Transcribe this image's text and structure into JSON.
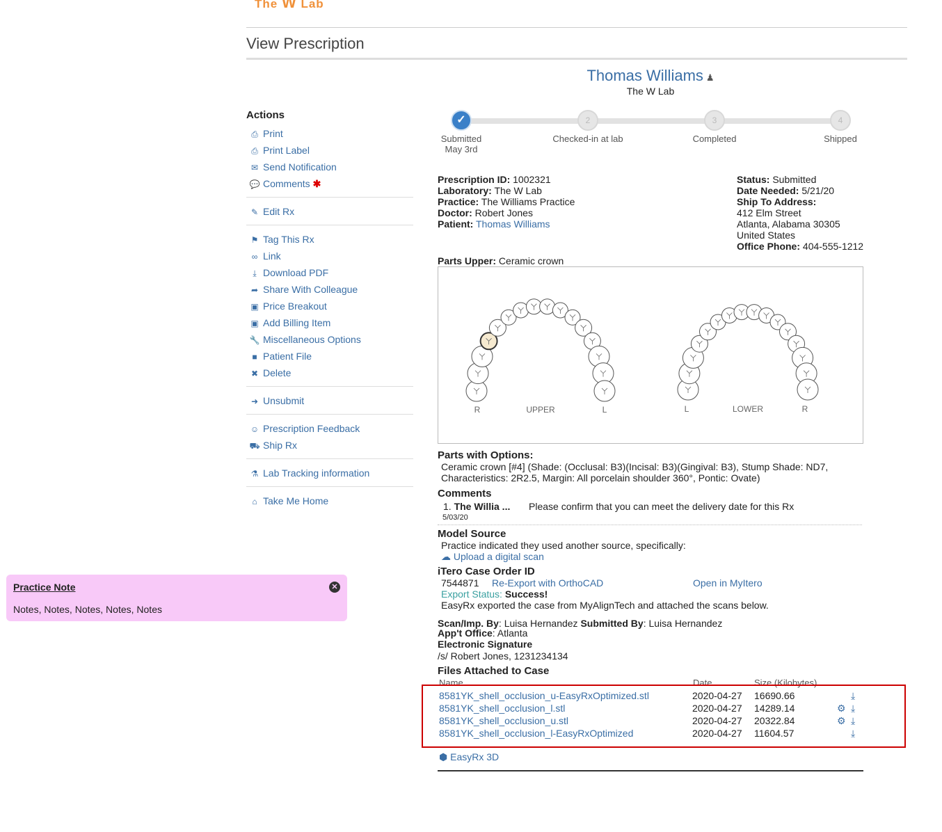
{
  "header": {
    "logo_pre": "The",
    "logo_w": "W",
    "logo_post": "Lab",
    "page_title": "View Prescription"
  },
  "patient_header": {
    "name": "Thomas Williams",
    "lab": "The W Lab"
  },
  "actions": {
    "title": "Actions",
    "groups": [
      [
        {
          "icon": "printer-icon",
          "label": "Print"
        },
        {
          "icon": "printer-icon",
          "label": "Print Label"
        },
        {
          "icon": "envelope-icon",
          "label": "Send Notification"
        },
        {
          "icon": "comments-icon",
          "label": "Comments"
        }
      ],
      [
        {
          "icon": "edit-icon",
          "label": "Edit Rx"
        }
      ],
      [
        {
          "icon": "tag-icon",
          "label": "Tag This Rx"
        },
        {
          "icon": "link-icon",
          "label": "Link"
        },
        {
          "icon": "download-icon",
          "label": "Download PDF"
        },
        {
          "icon": "share-icon",
          "label": "Share With Colleague"
        },
        {
          "icon": "money-icon",
          "label": "Price Breakout"
        },
        {
          "icon": "money-icon",
          "label": "Add Billing Item"
        },
        {
          "icon": "wrench-icon",
          "label": "Miscellaneous Options"
        },
        {
          "icon": "folder-icon",
          "label": "Patient File"
        },
        {
          "icon": "close-icon",
          "label": "Delete"
        }
      ],
      [
        {
          "icon": "arrow-left-icon",
          "label": "Unsubmit"
        }
      ],
      [
        {
          "icon": "smile-icon",
          "label": "Prescription Feedback"
        },
        {
          "icon": "truck-icon",
          "label": "Ship Rx"
        }
      ],
      [
        {
          "icon": "flask-icon",
          "label": "Lab Tracking information"
        }
      ],
      [
        {
          "icon": "home-icon",
          "label": "Take Me Home"
        }
      ]
    ]
  },
  "progress": {
    "steps": [
      {
        "number": "",
        "label": "Submitted",
        "sublabel": "May 3rd",
        "done": true
      },
      {
        "number": "2",
        "label": "Checked-in at lab",
        "sublabel": "",
        "done": false
      },
      {
        "number": "3",
        "label": "Completed",
        "sublabel": "",
        "done": false
      },
      {
        "number": "4",
        "label": "Shipped",
        "sublabel": "",
        "done": false
      }
    ]
  },
  "rx_info": {
    "prescription_id_label": "Prescription ID:",
    "prescription_id": "1002321",
    "laboratory_label": "Laboratory:",
    "laboratory": "The W Lab",
    "practice_label": "Practice:",
    "practice": "The Williams Practice",
    "doctor_label": "Doctor:",
    "doctor": "Robert Jones",
    "patient_label": "Patient:",
    "patient": "Thomas Williams",
    "status_label": "Status:",
    "status": "Submitted",
    "date_needed_label": "Date Needed:",
    "date_needed": "5/21/20",
    "ship_to_label": "Ship To Address:",
    "address_line1": "412 Elm Street",
    "address_line2": "Atlanta, Alabama 30305",
    "address_line3": "United States",
    "office_phone_label": "Office Phone:",
    "office_phone": "404-555-1212"
  },
  "parts": {
    "upper_label": "Parts Upper:",
    "upper_value": "Ceramic crown",
    "upper_arch_label": "UPPER",
    "lower_arch_label": "LOWER",
    "side_r": "R",
    "side_l": "L",
    "options_title": "Parts with Options:",
    "options_text": "Ceramic crown [#4] (Shade: (Occlusal: B3)(Incisal: B3)(Gingival: B3), Stump Shade: ND7, Characteristics: 2R2.5, Margin: All porcelain shoulder 360°, Pontic: Ovate)"
  },
  "comments": {
    "title": "Comments",
    "items": [
      {
        "index": "1.",
        "author": "The Willia ...",
        "date": "5/03/20",
        "text": "Please confirm that you can meet the delivery date for this Rx"
      }
    ]
  },
  "model_source": {
    "title": "Model Source",
    "text": "Practice indicated they used another source, specifically:",
    "upload_link": "Upload a digital scan"
  },
  "itero": {
    "title": "iTero Case Order ID",
    "order_id": "7544871",
    "reexport_link": "Re-Export with OrthoCAD",
    "open_link": "Open in MyItero",
    "export_status_label": "Export Status:",
    "export_status": "Success!",
    "export_note": "EasyRx exported the case from MyAlignTech and attached the scans below."
  },
  "scan": {
    "scan_by_label": "Scan/Imp. By",
    "scan_by": ": Luisa Hernandez",
    "submitted_by_label": "Submitted By",
    "submitted_by": ": Luisa Hernandez",
    "appt_office_label": "App't Office",
    "appt_office": ": Atlanta",
    "esig_label": "Electronic Signature",
    "esig_value": "/s/ Robert Jones, 1231234134"
  },
  "files": {
    "title": "Files Attached to Case",
    "col_name": "Name",
    "col_date": "Date",
    "col_size": "Size (Kilobytes)",
    "rows": [
      {
        "name": "8581YK_shell_occlusion_u-EasyRxOptimized.stl",
        "date": "2020-04-27",
        "size": "16690.66",
        "gear": false
      },
      {
        "name": "8581YK_shell_occlusion_l.stl",
        "date": "2020-04-27",
        "size": "14289.14",
        "gear": true
      },
      {
        "name": "8581YK_shell_occlusion_u.stl",
        "date": "2020-04-27",
        "size": "20322.84",
        "gear": true
      },
      {
        "name": "8581YK_shell_occlusion_l-EasyRxOptimized",
        "date": "2020-04-27",
        "size": "11604.57",
        "gear": false
      }
    ],
    "viewer_link": "EasyRx 3D"
  },
  "practice_note": {
    "title": "Practice Note",
    "text": "Notes, Notes, Notes, Notes, Notes"
  },
  "colors": {
    "link": "#3a6ea5",
    "accent_orange": "#f0913a",
    "note_bg": "#f8c9f8",
    "highlight_red": "#cc0000"
  }
}
